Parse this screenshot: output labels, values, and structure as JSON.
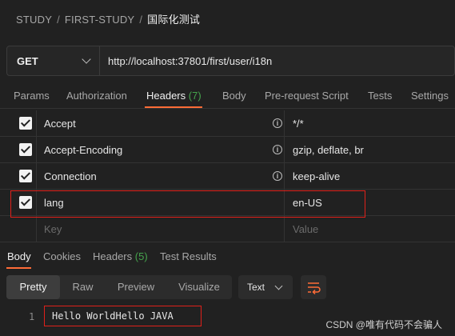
{
  "breadcrumb": {
    "parts": [
      "STUDY",
      "FIRST-STUDY"
    ],
    "current": "国际化测试"
  },
  "request": {
    "method": "GET",
    "url": "http://localhost:37801/first/user/i18n"
  },
  "request_tabs": {
    "params": "Params",
    "authorization": "Authorization",
    "headers": "Headers",
    "headers_count": "(7)",
    "body": "Body",
    "pre_request": "Pre-request Script",
    "tests": "Tests",
    "settings": "Settings"
  },
  "headers_table": {
    "rows": [
      {
        "key": "Accept",
        "value": "*/*",
        "checked": true,
        "info": true
      },
      {
        "key": "Accept-Encoding",
        "value": "gzip, deflate, br",
        "checked": true,
        "info": true
      },
      {
        "key": "Connection",
        "value": "keep-alive",
        "checked": true,
        "info": true
      },
      {
        "key": "lang",
        "value": "en-US",
        "checked": true,
        "info": false
      }
    ],
    "placeholder_key": "Key",
    "placeholder_value": "Value"
  },
  "response_tabs": {
    "body": "Body",
    "cookies": "Cookies",
    "headers": "Headers",
    "headers_count": "(5)",
    "test_results": "Test Results"
  },
  "view_modes": {
    "pretty": "Pretty",
    "raw": "Raw",
    "preview": "Preview",
    "visualize": "Visualize"
  },
  "format_select": "Text",
  "response": {
    "line_number": "1",
    "text": "Hello WorldHello JAVA"
  },
  "watermark": "CSDN @唯有代码不会骗人",
  "colors": {
    "accent": "#ff6c37",
    "count_green": "#45a34c",
    "highlight_red": "#e0201a"
  },
  "icons": {
    "info": "info-circle-icon",
    "wrap": "wrap-lines-icon"
  }
}
